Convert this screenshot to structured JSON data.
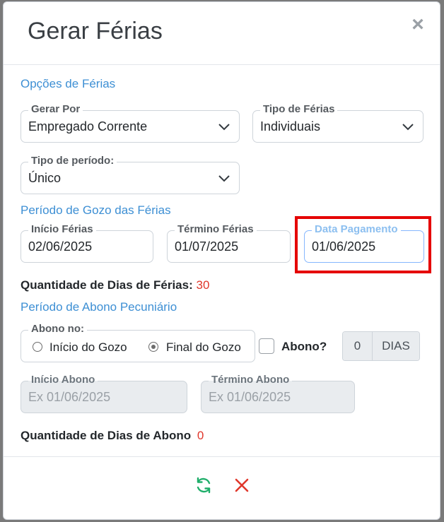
{
  "dialog": {
    "title": "Gerar Férias",
    "close_label": "×"
  },
  "opcoes": {
    "section_title": "Opções de Férias",
    "gerar_por": {
      "label": "Gerar Por",
      "value": "Empregado Corrente"
    },
    "tipo_ferias": {
      "label": "Tipo de Férias",
      "value": "Individuais"
    },
    "tipo_periodo": {
      "label": "Tipo de período:",
      "value": "Único"
    }
  },
  "gozo": {
    "section_title": "Período de Gozo das Férias",
    "inicio": {
      "label": "Início Férias",
      "value": "02/06/2025"
    },
    "termino": {
      "label": "Término Férias",
      "value": "01/07/2025"
    },
    "pagamento": {
      "label": "Data Pagamento",
      "value": "01/06/2025"
    },
    "quantidade_label": "Quantidade de Dias de Férias:",
    "quantidade_value": "30"
  },
  "abono": {
    "section_title": "Período de Abono Pecuniário",
    "abono_no_label": "Abono no:",
    "option_inicio": "Início do Gozo",
    "option_final": "Final do Gozo",
    "selected": "Final do Gozo",
    "checkbox_label": "Abono?",
    "dias_value": "0",
    "dias_addon": "DIAS",
    "inicio_abono": {
      "label": "Início Abono",
      "placeholder": "Ex 01/06/2025"
    },
    "termino_abono": {
      "label": "Término Abono",
      "placeholder": "Ex 01/06/2025"
    },
    "quantidade_label": "Quantidade de Dias de Abono",
    "quantidade_value": "0"
  },
  "footer": {
    "refresh_icon": "refresh-icon",
    "cancel_icon": "close-icon"
  },
  "colors": {
    "accent": "#3d8fd4",
    "danger": "#e0372b",
    "success": "#1fae6a",
    "highlight": "#e50000"
  }
}
